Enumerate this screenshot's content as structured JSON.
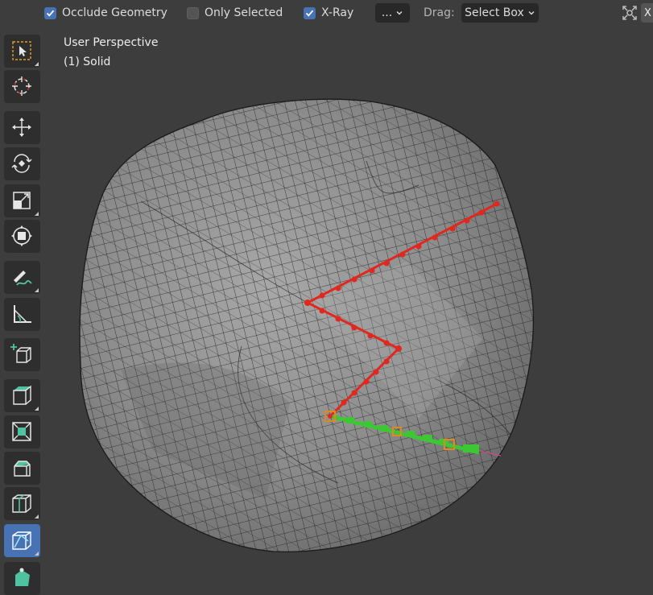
{
  "header": {
    "occlude_geometry": {
      "label": "Occlude Geometry",
      "checked": true
    },
    "only_selected": {
      "label": "Only Selected",
      "checked": false
    },
    "xray": {
      "label": "X-Ray",
      "checked": true
    },
    "more_dropdown": {
      "label": "..."
    },
    "drag_label": "Drag:",
    "drag_select": {
      "value": "Select Box"
    },
    "right_cut_label": "X"
  },
  "viewport": {
    "view_name": "User Perspective",
    "object_info": "(1) Solid"
  },
  "toolbar": {
    "tools": [
      {
        "name": "select-box-tool",
        "icon": "select-box-icon",
        "active": false
      },
      {
        "name": "cursor-tool",
        "icon": "cursor-icon",
        "active": false
      },
      {
        "name": "move-tool",
        "icon": "move-icon",
        "active": false
      },
      {
        "name": "rotate-tool",
        "icon": "rotate-icon",
        "active": false
      },
      {
        "name": "scale-tool",
        "icon": "scale-icon",
        "active": false
      },
      {
        "name": "transform-tool",
        "icon": "transform-icon",
        "active": false
      },
      {
        "name": "annotate-tool",
        "icon": "annotate-icon",
        "active": false
      },
      {
        "name": "measure-tool",
        "icon": "measure-icon",
        "active": false
      },
      {
        "name": "add-cube-tool",
        "icon": "add-cube-icon",
        "active": false
      },
      {
        "name": "extrude-tool",
        "icon": "extrude-icon",
        "active": false
      },
      {
        "name": "inset-tool",
        "icon": "inset-icon",
        "active": false
      },
      {
        "name": "bevel-tool",
        "icon": "bevel-icon",
        "active": false
      },
      {
        "name": "loop-cut-tool",
        "icon": "loop-cut-icon",
        "active": false
      },
      {
        "name": "knife-tool",
        "icon": "knife-icon",
        "active": true
      },
      {
        "name": "poly-build-tool",
        "icon": "poly-build-icon",
        "active": false
      }
    ]
  },
  "colors": {
    "accent": "#4772b3",
    "cut_red": "#e0281e",
    "cut_green": "#3cc832",
    "mesh_fill": "#8a8a8a",
    "wire": "#1a1a1a"
  }
}
